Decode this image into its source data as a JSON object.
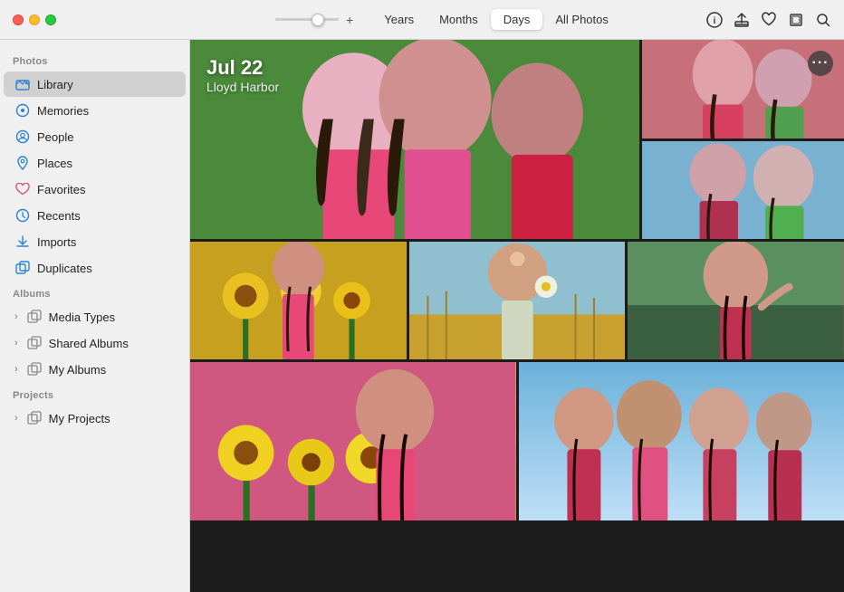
{
  "app": {
    "title": "Photos"
  },
  "titlebar": {
    "slider_plus": "+",
    "tabs": [
      {
        "id": "years",
        "label": "Years",
        "active": false
      },
      {
        "id": "months",
        "label": "Months",
        "active": false
      },
      {
        "id": "days",
        "label": "Days",
        "active": true
      },
      {
        "id": "all-photos",
        "label": "All Photos",
        "active": false
      }
    ]
  },
  "sidebar": {
    "sections": [
      {
        "id": "photos",
        "label": "Photos",
        "items": [
          {
            "id": "library",
            "label": "Library",
            "icon": "🖼",
            "active": true
          },
          {
            "id": "memories",
            "label": "Memories",
            "icon": "⊙",
            "active": false
          },
          {
            "id": "people",
            "label": "People",
            "icon": "⊙",
            "active": false
          },
          {
            "id": "places",
            "label": "Places",
            "icon": "📍",
            "active": false
          },
          {
            "id": "favorites",
            "label": "Favorites",
            "icon": "♡",
            "active": false
          },
          {
            "id": "recents",
            "label": "Recents",
            "icon": "⊙",
            "active": false
          },
          {
            "id": "imports",
            "label": "Imports",
            "icon": "↑",
            "active": false
          },
          {
            "id": "duplicates",
            "label": "Duplicates",
            "icon": "⧉",
            "active": false
          }
        ]
      },
      {
        "id": "albums",
        "label": "Albums",
        "items": [
          {
            "id": "media-types",
            "label": "Media Types",
            "icon": "⧉",
            "expandable": true
          },
          {
            "id": "shared-albums",
            "label": "Shared Albums",
            "icon": "⧉",
            "expandable": true
          },
          {
            "id": "my-albums",
            "label": "My Albums",
            "icon": "⧉",
            "expandable": true
          }
        ]
      },
      {
        "id": "projects",
        "label": "Projects",
        "items": [
          {
            "id": "my-projects",
            "label": "My Projects",
            "icon": "⧉",
            "expandable": true
          }
        ]
      }
    ]
  },
  "content": {
    "date": "Jul 22",
    "location": "Lloyd Harbor",
    "more_button": "···"
  }
}
